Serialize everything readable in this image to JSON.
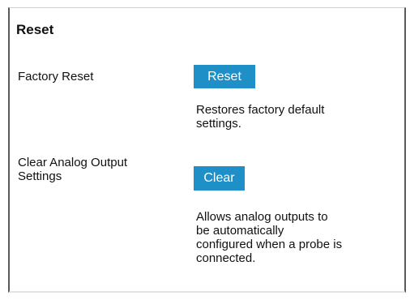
{
  "section": {
    "title": "Reset"
  },
  "factory_reset": {
    "label": "Factory Reset",
    "button_label": "Reset",
    "description_line1": "Restores factory default",
    "description_line2": "settings."
  },
  "clear_analog": {
    "label_line1": "Clear Analog Output",
    "label_line2": "Settings",
    "button_label": "Clear",
    "description_line1": "Allows analog outputs to",
    "description_line2": "be automatically",
    "description_line3": "configured when a probe is",
    "description_line4": "connected."
  },
  "colors": {
    "button_bg": "#1e8fc7",
    "button_text": "#ffffff",
    "panel_border": "#5a5a5a"
  }
}
